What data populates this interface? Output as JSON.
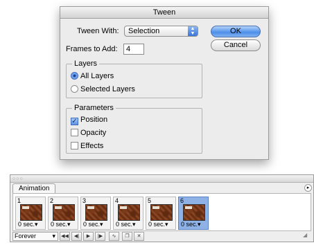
{
  "dialog": {
    "title": "Tween",
    "tween_with_label": "Tween With:",
    "tween_with_value": "Selection",
    "frames_to_add_label": "Frames to Add:",
    "frames_to_add_value": "4",
    "ok_label": "OK",
    "cancel_label": "Cancel",
    "layers": {
      "title": "Layers",
      "all_layers": "All Layers",
      "selected_layers": "Selected Layers",
      "selected": "All Layers"
    },
    "parameters": {
      "title": "Parameters",
      "position": "Position",
      "opacity": "Opacity",
      "effects": "Effects",
      "checked": [
        "Position"
      ]
    }
  },
  "animation": {
    "tab_label": "Animation",
    "frames": [
      {
        "number": "1",
        "delay": "0 sec."
      },
      {
        "number": "2",
        "delay": "0 sec."
      },
      {
        "number": "3",
        "delay": "0 sec."
      },
      {
        "number": "4",
        "delay": "0 sec."
      },
      {
        "number": "5",
        "delay": "0 sec."
      },
      {
        "number": "6",
        "delay": "0 sec."
      }
    ],
    "selected_frame": "6",
    "loop_value": "Forever"
  },
  "colors": {
    "accent": "#4d8ee8",
    "selected_frame": "#8eb1e6"
  }
}
